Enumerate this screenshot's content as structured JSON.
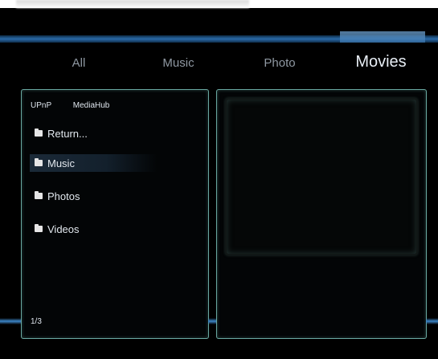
{
  "tabs": [
    {
      "label": "All",
      "active": false
    },
    {
      "label": "Music",
      "active": false
    },
    {
      "label": "Photo",
      "active": false
    },
    {
      "label": "Movies",
      "active": true
    }
  ],
  "browser": {
    "source": "UPnP",
    "server": "MediaHub",
    "items": [
      {
        "label": "Return...",
        "icon": "folder-icon",
        "selected": false
      },
      {
        "label": "Music",
        "icon": "folder-icon",
        "selected": true
      },
      {
        "label": "Photos",
        "icon": "folder-icon",
        "selected": false
      },
      {
        "label": "Videos",
        "icon": "folder-icon",
        "selected": false
      }
    ],
    "page": "1/3"
  },
  "colors": {
    "accent_blue": "#2a6aa8",
    "panel_border": "#6aa9a2",
    "background": "#000000"
  }
}
